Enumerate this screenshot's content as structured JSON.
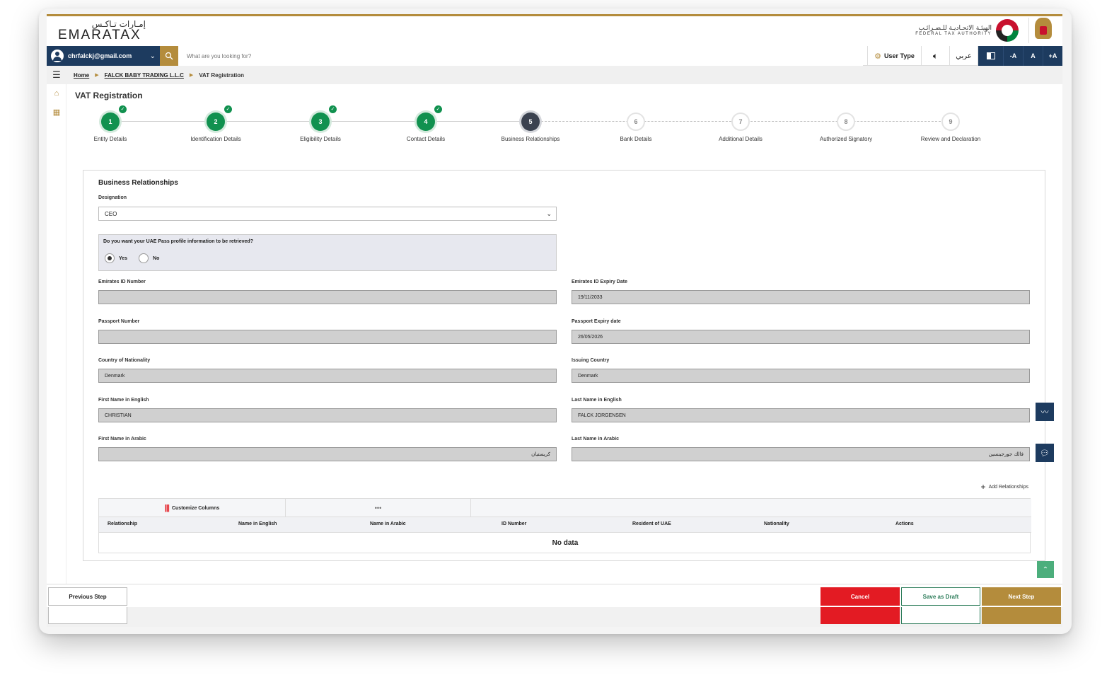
{
  "header": {
    "logo_ar": "إمـارات تـاكـس",
    "logo_en": "EMARATAX",
    "fta_ar": "الهيئـة الاتحـاديـة للـضـرائـب",
    "fta_en": "FEDERAL TAX AUTHORITY"
  },
  "navbar": {
    "user_email": "chrfalckj@gmail.com",
    "search_placeholder": "What are you looking for?",
    "user_type_label": "User Type",
    "arabic_label": "عربي",
    "font_decrease": "-A",
    "font_normal": "A",
    "font_increase": "+A"
  },
  "breadcrumb": {
    "home": "Home",
    "company": "FALCK BABY TRADING L.L.C",
    "current": "VAT Registration"
  },
  "page": {
    "title": "VAT Registration"
  },
  "stepper": {
    "steps": [
      {
        "num": "1",
        "label": "Entity Details",
        "status": "done"
      },
      {
        "num": "2",
        "label": "Identification Details",
        "status": "done"
      },
      {
        "num": "3",
        "label": "Eligibility Details",
        "status": "done"
      },
      {
        "num": "4",
        "label": "Contact Details",
        "status": "done"
      },
      {
        "num": "5",
        "label": "Business Relationships",
        "status": "active"
      },
      {
        "num": "6",
        "label": "Bank Details",
        "status": "pending"
      },
      {
        "num": "7",
        "label": "Additional Details",
        "status": "pending"
      },
      {
        "num": "8",
        "label": "Authorized Signatory",
        "status": "pending"
      },
      {
        "num": "9",
        "label": "Review and Declaration",
        "status": "pending"
      }
    ]
  },
  "form": {
    "section_title": "Business Relationships",
    "designation_label": "Designation",
    "designation_value": "CEO",
    "uaepass_question": "Do you want your UAE Pass profile information to be retrieved?",
    "yes_label": "Yes",
    "no_label": "No",
    "uaepass_selected": "Yes",
    "eid_label": "Emirates ID Number",
    "eid_value": "",
    "eid_expiry_label": "Emirates ID Expiry Date",
    "eid_expiry_value": "19/11/2033",
    "passport_label": "Passport Number",
    "passport_value": "",
    "passport_expiry_label": "Passport Expiry date",
    "passport_expiry_value": "26/05/2026",
    "nationality_label": "Country of Nationality",
    "nationality_value": "Denmark",
    "issuing_label": "Issuing Country",
    "issuing_value": "Denmark",
    "first_en_label": "First Name in English",
    "first_en_value": "CHRISTIAN",
    "last_en_label": "Last Name in English",
    "last_en_value": "FALCK JORGENSEN",
    "first_ar_label": "First Name in Arabic",
    "first_ar_value": "كريستيان",
    "last_ar_label": "Last Name in Arabic",
    "last_ar_value": "فالك جورجينسين",
    "add_relationships": "Add Relationships"
  },
  "grid": {
    "customize_label": "Customize Columns",
    "more_label": "•••",
    "columns": [
      "Relationship",
      "Name in English",
      "Name in Arabic",
      "ID Number",
      "Resident of UAE",
      "Nationality",
      "Actions"
    ],
    "empty_text": "No data"
  },
  "footer": {
    "previous": "Previous Step",
    "cancel": "Cancel",
    "draft": "Save as Draft",
    "next": "Next Step"
  },
  "colors": {
    "brand_gold": "#b48c3c",
    "navy": "#1d3b5f",
    "success_green": "#11914f",
    "cancel_red": "#e31b23"
  }
}
